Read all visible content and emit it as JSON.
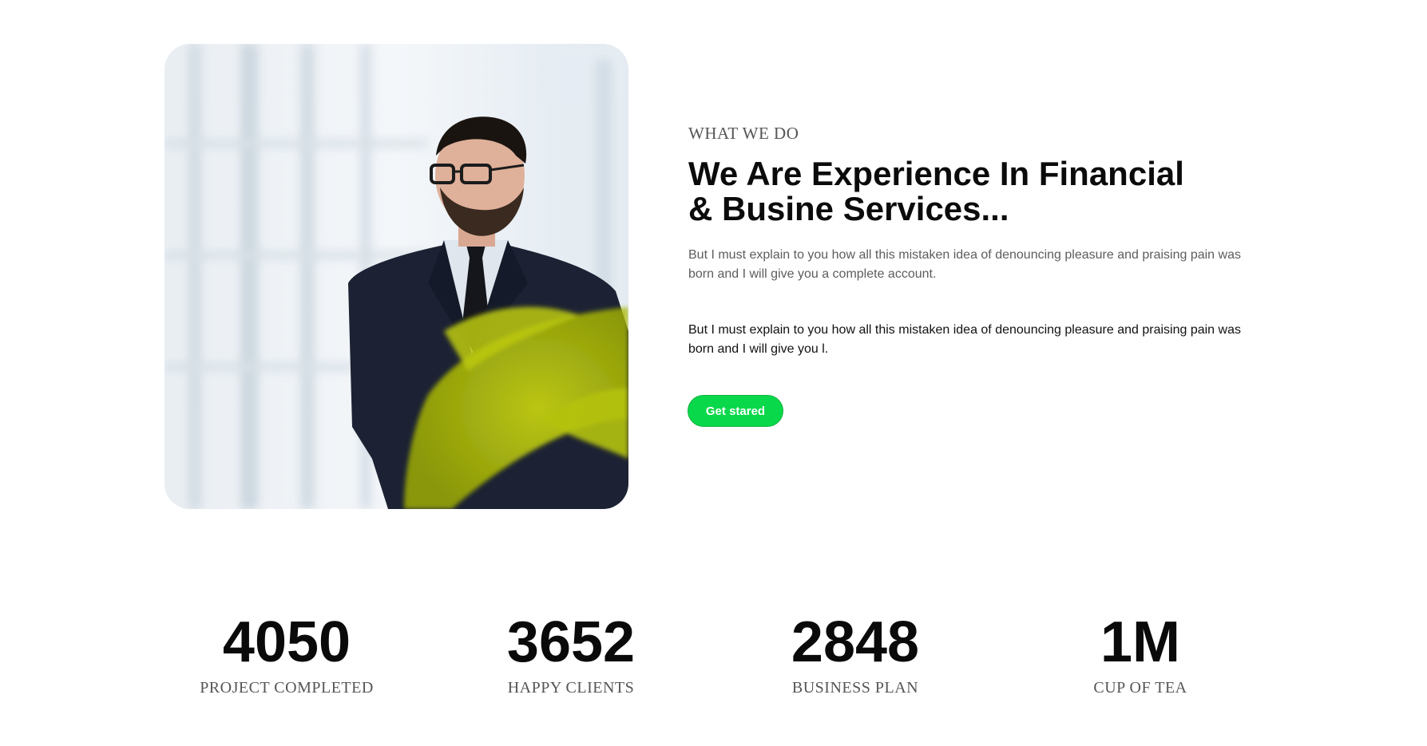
{
  "hero": {
    "eyebrow": "WHAT WE DO",
    "headline_line1": "We Are Experience In Financial",
    "headline_line2": "& Busine Services...",
    "body": "But I must explain to you how all this mistaken idea of denouncing pleasure and praising pain was born and I will give you a complete account.",
    "emphasis": "But I must explain to you how all this mistaken idea of denouncing pleasure and praising pain was born and I will give you l.",
    "cta_label": "Get stared"
  },
  "stats": [
    {
      "value": "4050",
      "label": "PROJECT COMPLETED"
    },
    {
      "value": "3652",
      "label": "HAPPY CLIENTS"
    },
    {
      "value": "2848",
      "label": "BUSINESS PLAN"
    },
    {
      "value": "1M",
      "label": "CUP OF TEA"
    }
  ],
  "colors": {
    "accent": "#0ad84b",
    "text_dark": "#0b0b0b",
    "text_muted": "#5d5d5d"
  }
}
